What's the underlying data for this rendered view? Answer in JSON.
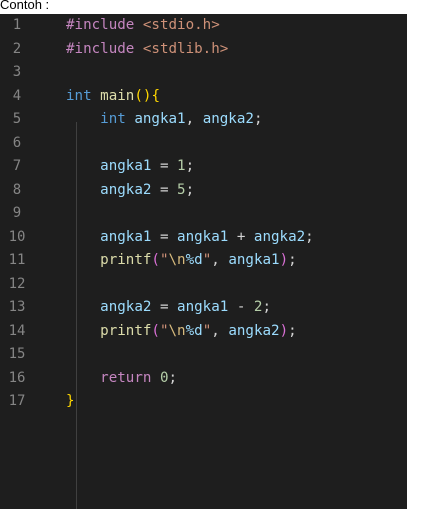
{
  "caption": "Contoh :",
  "editor": {
    "theme_colors": {
      "background": "#1e1e1e",
      "line_number": "#858585",
      "keyword": "#c586c0",
      "type": "#569cd6",
      "function": "#dcdcaa",
      "variable": "#9cdcfe",
      "number": "#b5cea8",
      "string": "#ce9178"
    },
    "lines": [
      {
        "num": "1",
        "tokens": [
          {
            "t": "#include",
            "c": "keyword"
          },
          {
            "t": " ",
            "c": "p"
          },
          {
            "t": "<stdio.h>",
            "c": "header"
          }
        ]
      },
      {
        "num": "2",
        "tokens": [
          {
            "t": "#include",
            "c": "keyword"
          },
          {
            "t": " ",
            "c": "p"
          },
          {
            "t": "<stdlib.h>",
            "c": "header"
          }
        ]
      },
      {
        "num": "3",
        "tokens": []
      },
      {
        "num": "4",
        "tokens": [
          {
            "t": "int",
            "c": "type"
          },
          {
            "t": " ",
            "c": "p"
          },
          {
            "t": "main",
            "c": "func"
          },
          {
            "t": "()",
            "c": "brace1"
          },
          {
            "t": "{",
            "c": "brace1"
          }
        ]
      },
      {
        "num": "5",
        "tokens": [
          {
            "t": "    ",
            "c": "p"
          },
          {
            "t": "int",
            "c": "type"
          },
          {
            "t": " ",
            "c": "p"
          },
          {
            "t": "angka1",
            "c": "var"
          },
          {
            "t": ", ",
            "c": "p"
          },
          {
            "t": "angka2",
            "c": "var"
          },
          {
            "t": ";",
            "c": "p"
          }
        ]
      },
      {
        "num": "6",
        "tokens": []
      },
      {
        "num": "7",
        "tokens": [
          {
            "t": "    ",
            "c": "p"
          },
          {
            "t": "angka1",
            "c": "var"
          },
          {
            "t": " = ",
            "c": "p"
          },
          {
            "t": "1",
            "c": "num"
          },
          {
            "t": ";",
            "c": "p"
          }
        ]
      },
      {
        "num": "8",
        "tokens": [
          {
            "t": "    ",
            "c": "p"
          },
          {
            "t": "angka2",
            "c": "var"
          },
          {
            "t": " = ",
            "c": "p"
          },
          {
            "t": "5",
            "c": "num"
          },
          {
            "t": ";",
            "c": "p"
          }
        ]
      },
      {
        "num": "9",
        "tokens": []
      },
      {
        "num": "10",
        "tokens": [
          {
            "t": "    ",
            "c": "p"
          },
          {
            "t": "angka1",
            "c": "var"
          },
          {
            "t": " = ",
            "c": "p"
          },
          {
            "t": "angka1",
            "c": "var"
          },
          {
            "t": " + ",
            "c": "p"
          },
          {
            "t": "angka2",
            "c": "var"
          },
          {
            "t": ";",
            "c": "p"
          }
        ]
      },
      {
        "num": "11",
        "tokens": [
          {
            "t": "    ",
            "c": "p"
          },
          {
            "t": "printf",
            "c": "func"
          },
          {
            "t": "(",
            "c": "brace2"
          },
          {
            "t": "\"",
            "c": "str"
          },
          {
            "t": "\\n",
            "c": "esc"
          },
          {
            "t": "%d",
            "c": "var"
          },
          {
            "t": "\"",
            "c": "str"
          },
          {
            "t": ", ",
            "c": "p"
          },
          {
            "t": "angka1",
            "c": "var"
          },
          {
            "t": ")",
            "c": "brace2"
          },
          {
            "t": ";",
            "c": "p"
          }
        ]
      },
      {
        "num": "12",
        "tokens": []
      },
      {
        "num": "13",
        "tokens": [
          {
            "t": "    ",
            "c": "p"
          },
          {
            "t": "angka2",
            "c": "var"
          },
          {
            "t": " = ",
            "c": "p"
          },
          {
            "t": "angka1",
            "c": "var"
          },
          {
            "t": " - ",
            "c": "p"
          },
          {
            "t": "2",
            "c": "num"
          },
          {
            "t": ";",
            "c": "p"
          }
        ]
      },
      {
        "num": "14",
        "tokens": [
          {
            "t": "    ",
            "c": "p"
          },
          {
            "t": "printf",
            "c": "func"
          },
          {
            "t": "(",
            "c": "brace2"
          },
          {
            "t": "\"",
            "c": "str"
          },
          {
            "t": "\\n",
            "c": "esc"
          },
          {
            "t": "%d",
            "c": "var"
          },
          {
            "t": "\"",
            "c": "str"
          },
          {
            "t": ", ",
            "c": "p"
          },
          {
            "t": "angka2",
            "c": "var"
          },
          {
            "t": ")",
            "c": "brace2"
          },
          {
            "t": ";",
            "c": "p"
          }
        ]
      },
      {
        "num": "15",
        "tokens": []
      },
      {
        "num": "16",
        "tokens": [
          {
            "t": "    ",
            "c": "p"
          },
          {
            "t": "return",
            "c": "keyword"
          },
          {
            "t": " ",
            "c": "p"
          },
          {
            "t": "0",
            "c": "num"
          },
          {
            "t": ";",
            "c": "p"
          }
        ]
      },
      {
        "num": "17",
        "tokens": [
          {
            "t": "}",
            "c": "brace1"
          }
        ]
      }
    ]
  }
}
